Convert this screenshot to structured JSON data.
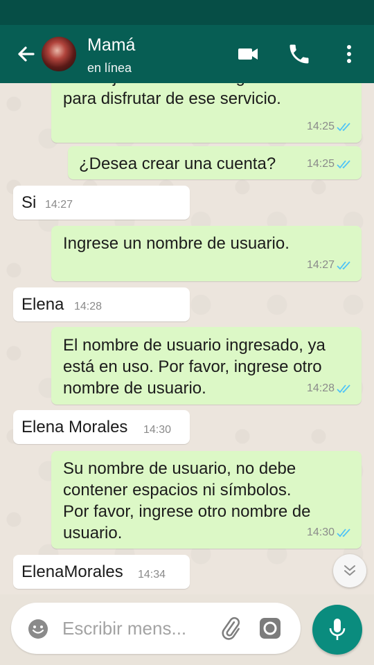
{
  "header": {
    "contact_name": "Mamá",
    "status": "en línea",
    "colors": {
      "appbar": "#075e54",
      "statusbar": "#064e46"
    },
    "icons": [
      "back-arrow-icon",
      "video-call-icon",
      "phone-icon",
      "more-vert-icon"
    ]
  },
  "messages": [
    {
      "direction": "outgoing",
      "text": "mensaje. Debe estar registrado\npara disfrutar de ese servicio.",
      "time": "14:25",
      "status": "read"
    },
    {
      "direction": "outgoing",
      "text": "¿Desea crear una cuenta?",
      "time": "14:25",
      "status": "read"
    },
    {
      "direction": "incoming",
      "text": "Si",
      "time": "14:27"
    },
    {
      "direction": "outgoing",
      "text": "Ingrese un nombre de usuario.",
      "time": "14:27",
      "status": "read"
    },
    {
      "direction": "incoming",
      "text": "Elena",
      "time": "14:28"
    },
    {
      "direction": "outgoing",
      "text": "El nombre de usuario ingresado, ya\nestá en uso. Por favor, ingrese otro\nnombre de usuario.",
      "time": "14:28",
      "status": "read"
    },
    {
      "direction": "incoming",
      "text": "Elena Morales",
      "time": "14:30"
    },
    {
      "direction": "outgoing",
      "text": "Su nombre de usuario, no debe\ncontener espacios ni símbolos.\nPor favor, ingrese otro nombre de\nusuario.",
      "time": "14:30",
      "status": "read"
    },
    {
      "direction": "incoming",
      "text": "ElenaMorales",
      "time": "14:34"
    }
  ],
  "composer": {
    "placeholder": "Escribir mens...",
    "icons": [
      "emoji-icon",
      "attach-icon",
      "camera-icon",
      "mic-icon"
    ],
    "colors": {
      "mic_button": "#0a8c7e",
      "outgoing_bubble": "#dcf8c6",
      "read_ticks": "#4fc3f7"
    }
  }
}
